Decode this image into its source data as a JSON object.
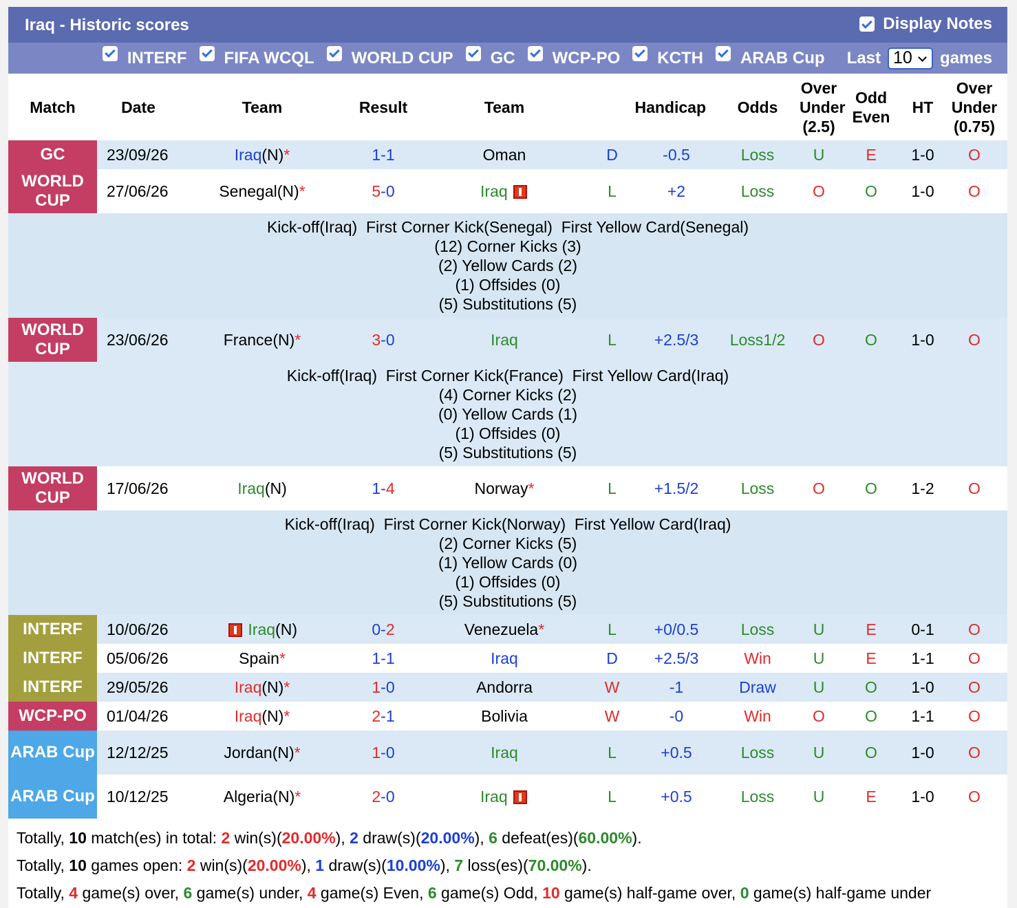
{
  "header": {
    "title": "Iraq - Historic scores",
    "display_notes": "Display Notes",
    "filters": [
      "INTERF",
      "FIFA WCQL",
      "WORLD CUP",
      "GC",
      "WCP-PO",
      "KCTH",
      "ARAB Cup"
    ],
    "last_label": "Last",
    "last_value": "10",
    "games_label": "games"
  },
  "columns": {
    "match": "Match",
    "date": "Date",
    "team1": "Team",
    "result": "Result",
    "team2": "Team",
    "handicap": "Handicap",
    "odds": "Odds",
    "ou_a": "Over",
    "ou_b": "Under",
    "ou_c": "(2.5)",
    "oe_a": "Odd",
    "oe_b": "Even",
    "ht": "HT",
    "ou2_a": "Over",
    "ou2_b": "Under",
    "ou2_c": "(0.75)"
  },
  "matches": [
    {
      "comp": "GC",
      "date": "23/09/26",
      "home": "Iraq",
      "home_suffix": "(N)",
      "home_star": "*",
      "hg": "1",
      "ag": "1",
      "away": "Oman",
      "away_star": "",
      "wdl": "D",
      "hcap": "-0.5",
      "odds": "Loss",
      "ou": "U",
      "oe": "E",
      "ht": "1-0",
      "ou2": "O"
    },
    {
      "comp": "WORLD CUP",
      "date": "27/06/26",
      "home": "Senegal",
      "home_suffix": "(N)",
      "home_star": "*",
      "hg": "5",
      "ag": "0",
      "away": "Iraq",
      "away_star": "",
      "wdl": "L",
      "hcap": "+2",
      "odds": "Loss",
      "ou": "O",
      "oe": "O",
      "ht": "1-0",
      "ou2": "O",
      "note": [
        "Kick-off(Iraq)  First Corner Kick(Senegal)  First Yellow Card(Senegal)",
        "(12) Corner Kicks (3)",
        "(2) Yellow Cards (2)",
        "(1) Offsides (0)",
        "(5) Substitutions (5)"
      ]
    },
    {
      "comp": "WORLD CUP",
      "date": "23/06/26",
      "home": "France",
      "home_suffix": "(N)",
      "home_star": "*",
      "hg": "3",
      "ag": "0",
      "away": "Iraq",
      "away_star": "",
      "wdl": "L",
      "hcap": "+2.5/3",
      "odds": "Loss1/2",
      "ou": "O",
      "oe": "O",
      "ht": "1-0",
      "ou2": "O",
      "note": [
        "Kick-off(Iraq)  First Corner Kick(France)  First Yellow Card(Iraq)",
        "(4) Corner Kicks (2)",
        "(0) Yellow Cards (1)",
        "(1) Offsides (0)",
        "(5) Substitutions (5)"
      ]
    },
    {
      "comp": "WORLD CUP",
      "date": "17/06/26",
      "home": "Iraq",
      "home_suffix": "(N)",
      "home_star": "",
      "hg": "1",
      "ag": "4",
      "away": "Norway",
      "away_star": "*",
      "wdl": "L",
      "hcap": "+1.5/2",
      "odds": "Loss",
      "ou": "O",
      "oe": "O",
      "ht": "1-2",
      "ou2": "O",
      "note": [
        "Kick-off(Iraq)  First Corner Kick(Norway)  First Yellow Card(Iraq)",
        "(2) Corner Kicks (5)",
        "(1) Yellow Cards (0)",
        "(1) Offsides (0)",
        "(5) Substitutions (5)"
      ]
    },
    {
      "comp": "INTERF",
      "date": "10/06/26",
      "home": "Iraq",
      "home_suffix": "(N)",
      "home_star": "",
      "hg": "0",
      "ag": "2",
      "away": "Venezuela",
      "away_star": "*",
      "wdl": "L",
      "hcap": "+0/0.5",
      "odds": "Loss",
      "ou": "U",
      "oe": "E",
      "ht": "0-1",
      "ou2": "O"
    },
    {
      "comp": "INTERF",
      "date": "05/06/26",
      "home": "Spain",
      "home_suffix": "",
      "home_star": "*",
      "hg": "1",
      "ag": "1",
      "away": "Iraq",
      "away_star": "",
      "wdl": "D",
      "hcap": "+2.5/3",
      "odds": "Win",
      "ou": "U",
      "oe": "E",
      "ht": "1-1",
      "ou2": "O"
    },
    {
      "comp": "INTERF",
      "date": "29/05/26",
      "home": "Iraq",
      "home_suffix": "(N)",
      "home_star": "*",
      "hg": "1",
      "ag": "0",
      "away": "Andorra",
      "away_star": "",
      "wdl": "W",
      "hcap": "-1",
      "odds": "Draw",
      "ou": "U",
      "oe": "O",
      "ht": "1-0",
      "ou2": "O"
    },
    {
      "comp": "WCP-PO",
      "date": "01/04/26",
      "home": "Iraq",
      "home_suffix": "(N)",
      "home_star": "*",
      "hg": "2",
      "ag": "1",
      "away": "Bolivia",
      "away_star": "",
      "wdl": "W",
      "hcap": "-0",
      "odds": "Win",
      "ou": "O",
      "oe": "O",
      "ht": "1-1",
      "ou2": "O"
    },
    {
      "comp": "ARAB Cup",
      "date": "12/12/25",
      "home": "Jordan",
      "home_suffix": "(N)",
      "home_star": "*",
      "hg": "1",
      "ag": "0",
      "away": "Iraq",
      "away_star": "",
      "wdl": "L",
      "hcap": "+0.5",
      "odds": "Loss",
      "ou": "U",
      "oe": "O",
      "ht": "1-0",
      "ou2": "O"
    },
    {
      "comp": "ARAB Cup",
      "date": "10/12/25",
      "home": "Algeria",
      "home_suffix": "(N)",
      "home_star": "*",
      "hg": "2",
      "ag": "0",
      "away": "Iraq",
      "away_star": "",
      "wdl": "L",
      "hcap": "+0.5",
      "odds": "Loss",
      "ou": "U",
      "oe": "E",
      "ht": "1-0",
      "ou2": "O"
    }
  ],
  "summary": {
    "line1": {
      "a": "Totally, ",
      "n1": "10",
      "b": " match(es) in total: ",
      "w": "2",
      "c": " win(s)(",
      "wp": "20.00%",
      "d": "), ",
      "dr": "2",
      "e": " draw(s)(",
      "dp": "20.00%",
      "f": "), ",
      "l": "6",
      "g": " defeat(es)(",
      "lp": "60.00%",
      "h": ")."
    },
    "line2": {
      "a": "Totally, ",
      "n1": "10",
      "b": " games open: ",
      "w": "2",
      "c": " win(s)(",
      "wp": "20.00%",
      "d": "), ",
      "dr": "1",
      "e": " draw(s)(",
      "dp": "10.00%",
      "f": "), ",
      "l": "7",
      "g": " loss(es)(",
      "lp": "70.00%",
      "h": ")."
    },
    "line3": {
      "a": "Totally, ",
      "over": "4",
      "b": " game(s) over, ",
      "under": "6",
      "c": " game(s) under, ",
      "even": "4",
      "d": " game(s) Even, ",
      "odd": "6",
      "e": " game(s) Odd, ",
      "hgo": "10",
      "f": " game(s) half-game over, ",
      "hgu": "0",
      "g": " game(s) half-game under"
    }
  },
  "colors": {
    "header": "#5b6bb0",
    "subheader": "#7b87c4",
    "wc": "#c43d63",
    "interf": "#a39f3e",
    "arab": "#4ea7e6",
    "row_stripe": "#dae9f5"
  }
}
